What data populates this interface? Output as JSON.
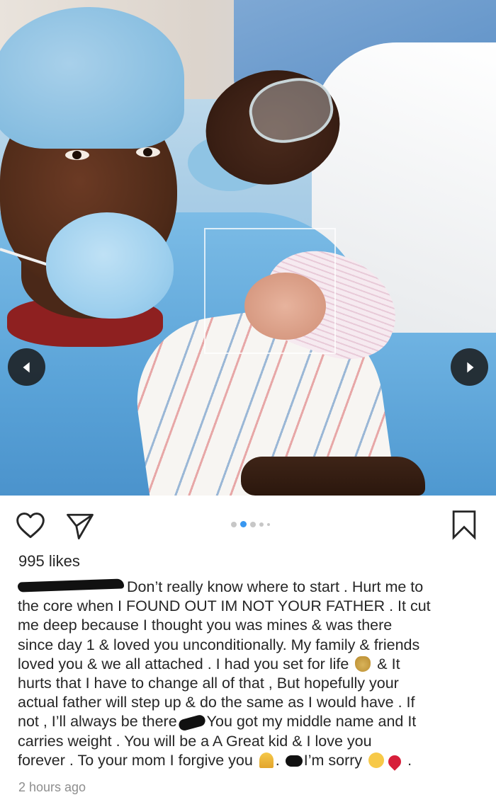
{
  "post": {
    "carousel": {
      "prev_label": "Previous",
      "next_label": "Next",
      "dot_count": 5,
      "active_dot": 1
    },
    "likes_text": "995 likes",
    "caption_lines": [
      "Don’t really know where to start . Hurt me to",
      "the core when I FOUND OUT IM NOT YOUR FATHER . It cut",
      "me deep because I thought you was mines & was there",
      "since day 1 & loved you unconditionally. My family & friends",
      "loved you & we all attached . I had you set for life",
      "& It",
      "hurts that I have to change all of that , But hopefully your",
      "actual father will step up & do the same as I would have . If",
      "not , I’ll always be there",
      "You got my middle name and It",
      "carries weight . You will be a A Great kid & I love you",
      "forever . To your mom I forgive you",
      ".",
      "I’m sorry",
      "."
    ],
    "timestamp": "2 hours ago"
  },
  "icons": {
    "like": "heart-icon",
    "share": "send-icon",
    "save": "bookmark-icon",
    "prev": "chevron-left-icon",
    "next": "chevron-right-icon",
    "emoji_money": "money-bag-emoji",
    "emoji_pray": "folded-hands-emoji",
    "emoji_pensive": "pensive-face-emoji",
    "emoji_broken": "broken-heart-emoji"
  },
  "colors": {
    "text": "#262626",
    "muted": "#8e8e8e",
    "active_dot": "#3897f0",
    "inactive_dot": "#c7c7c7"
  }
}
